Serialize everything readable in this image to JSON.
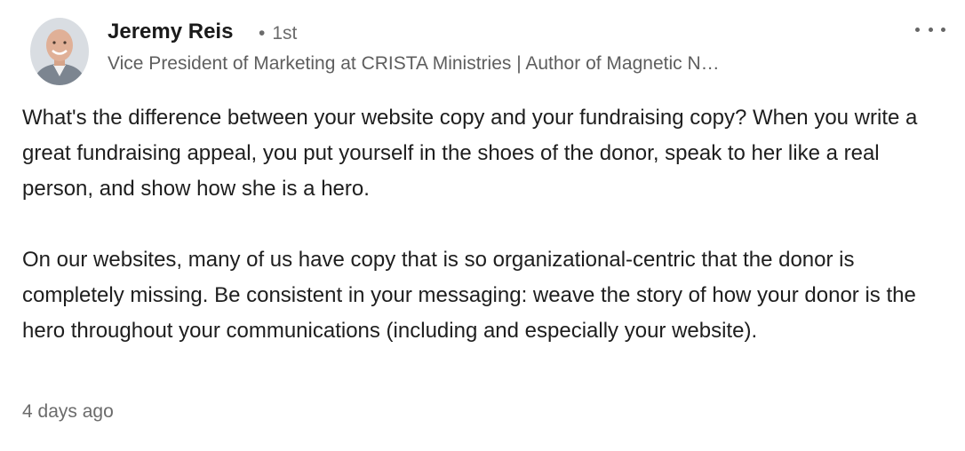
{
  "author": {
    "name": "Jeremy Reis",
    "connection_degree": "1st",
    "separator": "•",
    "headline": "Vice President of Marketing at CRISTA Ministries | Author of Magnetic N…",
    "avatar_icon": "person-photo"
  },
  "post": {
    "paragraphs": [
      "What's the difference between your website copy and your fundraising copy? When you write a great fundraising appeal, you put yourself in the shoes of the donor, speak to her like a real person, and show how she is a hero.",
      "On our websites, many of us have copy that is so organizational-centric that the donor is completely missing. Be consistent in your messaging: weave the story of how your donor is the hero throughout your communications (including and especially your website)."
    ],
    "timestamp": "4 days ago"
  },
  "menu": {
    "icon": "ellipsis-icon"
  },
  "colors": {
    "text": "#1e1e1e",
    "secondary_text": "#6b6b6b",
    "background": "#ffffff"
  }
}
